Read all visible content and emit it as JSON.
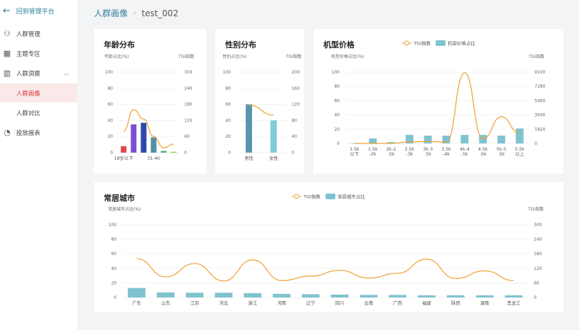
{
  "sidebar": {
    "back_label": "回到管理平台",
    "items": [
      {
        "label": "人群管理",
        "icon": "user-add-icon"
      },
      {
        "label": "主题专区",
        "icon": "grid-icon"
      },
      {
        "label": "人群洞察",
        "icon": "bar-chart-icon",
        "expanded": true
      },
      {
        "label": "人群画像",
        "active": true
      },
      {
        "label": "人群对比"
      },
      {
        "label": "投放报表",
        "icon": "pie-chart-icon"
      }
    ]
  },
  "breadcrumb": {
    "parent": "人群画像",
    "separator": "‹",
    "current": "test_002"
  },
  "colors": {
    "line": "#f0a030",
    "bar": "#7fc3d0",
    "accent": "#2f7f9a",
    "active": "#d9383e"
  },
  "chart_data": [
    {
      "id": "age",
      "title": "年龄分布",
      "type": "bar+line",
      "ylabel": "年龄占比(%)",
      "y2label": "TGI指数",
      "ylim": [
        0,
        100
      ],
      "y2lim": [
        0,
        300
      ],
      "yticks": [
        "100",
        "80",
        "60",
        "40",
        "20",
        "0"
      ],
      "y2ticks": [
        "300",
        "240",
        "180",
        "120",
        "60",
        "0"
      ],
      "categories": [
        "18岁以下",
        "",
        "",
        "31-40",
        "",
        ""
      ],
      "values": [
        8,
        35,
        37,
        19,
        2,
        1
      ],
      "bar_colors": [
        "#e04848",
        "#7b4fd0",
        "#2a4aa8",
        "#5290a8",
        "#4aa878",
        "#8ac040"
      ],
      "tgi": [
        80,
        160,
        125,
        60,
        18,
        32
      ]
    },
    {
      "id": "gender",
      "title": "性别分布",
      "type": "bar+line",
      "ylabel": "性别占比(%)",
      "y2label": "TGI指数",
      "ylim": [
        0,
        100
      ],
      "y2lim": [
        0,
        200
      ],
      "yticks": [
        "100",
        "80",
        "60",
        "40",
        "20",
        "0"
      ],
      "y2ticks": [
        "200",
        "160",
        "120",
        "80",
        "40",
        "0"
      ],
      "categories": [
        "男性",
        "女性"
      ],
      "values": [
        60,
        40
      ],
      "bar_colors": [
        "#5a96aa",
        "#80ccd8"
      ],
      "tgi": [
        118,
        93
      ]
    },
    {
      "id": "price",
      "title": "机型价格",
      "type": "bar+line",
      "ylabel": "机型价格占比(%)",
      "y2label": "TGI指数",
      "ylim": [
        0,
        100
      ],
      "y2lim": [
        0,
        9100
      ],
      "legend": [
        "TGI指数",
        "机型价格占比"
      ],
      "yticks": [
        "100",
        "80",
        "60",
        "40",
        "20",
        "0"
      ],
      "y2ticks": [
        "9100",
        "7280",
        "5460",
        "3640",
        "1820",
        "0"
      ],
      "categories": [
        "1.5k\n以下",
        "1.5k\n-2k",
        "2k-2\n.5k",
        "2.5k\n-3k",
        "3k-3\n.5k",
        "3.5k\n-4k",
        "4k-4\n.5k",
        "4.5k\n-5k",
        "5k-5\n.5k",
        "5.5k\n以上"
      ],
      "values": [
        0.5,
        7,
        2,
        12,
        11,
        11,
        12,
        12,
        11,
        21
      ],
      "tgi": [
        0,
        0,
        0,
        200,
        250,
        150,
        9000,
        600,
        3400,
        1300
      ]
    },
    {
      "id": "city",
      "title": "常居城市",
      "type": "bar+line",
      "ylabel": "常居城市占比(%)",
      "y2label": "TGI指数",
      "ylim": [
        0,
        100
      ],
      "y2lim": [
        0,
        300
      ],
      "legend": [
        "TGI指数",
        "常居城市占比"
      ],
      "yticks": [
        "100",
        "80",
        "60",
        "40",
        "20",
        "0"
      ],
      "y2ticks": [
        "300",
        "240",
        "180",
        "120",
        "60",
        "0"
      ],
      "categories": [
        "广东",
        "山东",
        "江苏",
        "河北",
        "浙江",
        "河南",
        "辽宁",
        "四川",
        "云南",
        "广西",
        "福建",
        "陕西",
        "湖南",
        "黑龙江"
      ],
      "values": [
        13,
        7,
        6.5,
        6.5,
        6,
        5,
        4.5,
        4,
        3.5,
        3.5,
        3,
        3,
        3,
        3
      ],
      "tgi": [
        160,
        85,
        140,
        68,
        155,
        70,
        88,
        112,
        80,
        100,
        158,
        78,
        110,
        70
      ]
    }
  ]
}
